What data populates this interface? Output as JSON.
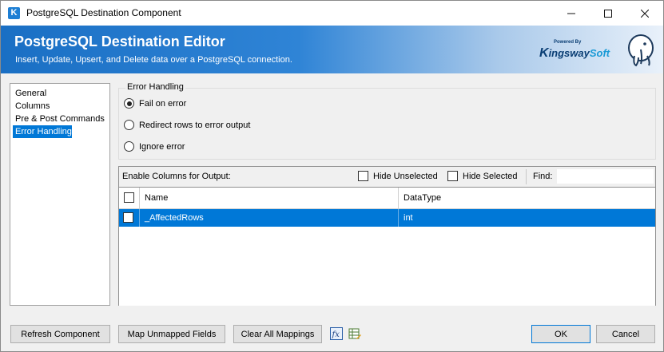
{
  "window": {
    "title": "PostgreSQL Destination Component",
    "app_icon_glyph": "K",
    "controls": {
      "minimize": "—",
      "maximize": "☐",
      "close": "✕"
    }
  },
  "banner": {
    "title": "PostgreSQL Destination Editor",
    "subtitle": "Insert, Update, Upsert, and Delete data over a PostgreSQL connection.",
    "brand": {
      "powered_by": "Powered By",
      "name_k": "K",
      "name_ingsway": "ingsway",
      "name_soft": "Soft"
    },
    "colors": {
      "gradient_start": "#1a6fc4",
      "gradient_end": "#e9f1fa"
    }
  },
  "nav": {
    "items": [
      {
        "label": "General",
        "selected": false
      },
      {
        "label": "Columns",
        "selected": false
      },
      {
        "label": "Pre & Post Commands",
        "selected": false
      },
      {
        "label": "Error Handling",
        "selected": true
      }
    ]
  },
  "error_handling": {
    "legend": "Error Handling",
    "options": [
      {
        "label": "Fail on error",
        "checked": true
      },
      {
        "label": "Redirect rows to error output",
        "checked": false
      },
      {
        "label": "Ignore error",
        "checked": false
      }
    ]
  },
  "output": {
    "label": "Enable Columns for Output:",
    "hide_unselected": "Hide Unselected",
    "hide_selected": "Hide Selected",
    "find_label": "Find:",
    "find_value": "",
    "columns": [
      "Name",
      "DataType"
    ],
    "rows": [
      {
        "name": "_AffectedRows",
        "datatype": "int",
        "checked": false,
        "selected": true
      }
    ]
  },
  "buttons": {
    "refresh": "Refresh Component",
    "map_unmapped": "Map Unmapped Fields",
    "clear_mappings": "Clear All Mappings",
    "ok": "OK",
    "cancel": "Cancel"
  },
  "icons": {
    "fx": "function-icon",
    "edit": "edit-table-icon"
  },
  "accent_color": "#0078d7"
}
